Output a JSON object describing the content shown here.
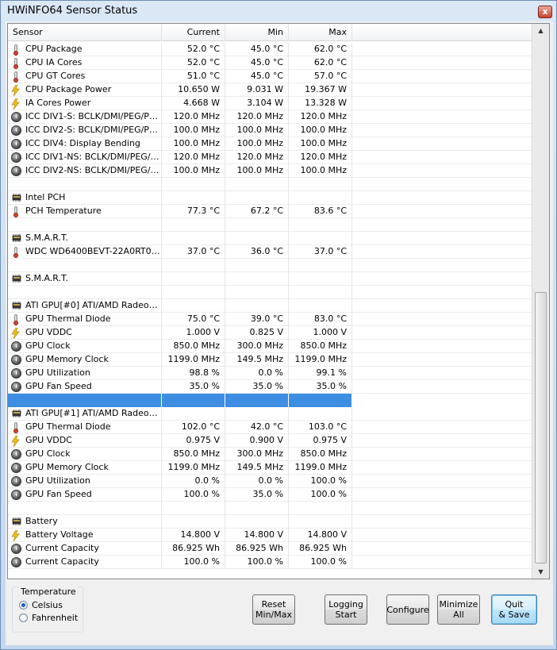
{
  "window": {
    "title": "HWiNFO64 Sensor Status",
    "close_label": "x"
  },
  "table": {
    "columns": [
      "Sensor",
      "Current",
      "Min",
      "Max"
    ],
    "rows": [
      {
        "type": "sensor",
        "icon": "thermometer-icon",
        "name": "CPU Package",
        "current": "52.0 °C",
        "min": "45.0 °C",
        "max": "62.0 °C"
      },
      {
        "type": "sensor",
        "icon": "thermometer-icon",
        "name": "CPU IA Cores",
        "current": "52.0 °C",
        "min": "45.0 °C",
        "max": "62.0 °C"
      },
      {
        "type": "sensor",
        "icon": "thermometer-icon",
        "name": "CPU GT Cores",
        "current": "51.0 °C",
        "min": "45.0 °C",
        "max": "57.0 °C"
      },
      {
        "type": "sensor",
        "icon": "lightning-icon",
        "name": "CPU Package Power",
        "current": "10.650 W",
        "min": "9.031 W",
        "max": "19.367 W"
      },
      {
        "type": "sensor",
        "icon": "lightning-icon",
        "name": "IA Cores Power",
        "current": "4.668 W",
        "min": "3.104 W",
        "max": "13.328 W"
      },
      {
        "type": "sensor",
        "icon": "clock-icon",
        "name": "ICC DIV1-S: BCLK/DMI/PEG/PCI...",
        "current": "120.0 MHz",
        "min": "120.0 MHz",
        "max": "120.0 MHz"
      },
      {
        "type": "sensor",
        "icon": "clock-icon",
        "name": "ICC DIV2-S: BCLK/DMI/PEG/PCI...",
        "current": "100.0 MHz",
        "min": "100.0 MHz",
        "max": "100.0 MHz"
      },
      {
        "type": "sensor",
        "icon": "clock-icon",
        "name": "ICC DIV4: Display Bending",
        "current": "100.0 MHz",
        "min": "100.0 MHz",
        "max": "100.0 MHz"
      },
      {
        "type": "sensor",
        "icon": "clock-icon",
        "name": "ICC DIV1-NS: BCLK/DMI/PEG/PC...",
        "current": "120.0 MHz",
        "min": "120.0 MHz",
        "max": "120.0 MHz"
      },
      {
        "type": "sensor",
        "icon": "clock-icon",
        "name": "ICC DIV2-NS: BCLK/DMI/PEG/PC...",
        "current": "100.0 MHz",
        "min": "100.0 MHz",
        "max": "100.0 MHz"
      },
      {
        "type": "blank"
      },
      {
        "type": "group",
        "icon": "chip-icon",
        "name": "Intel PCH"
      },
      {
        "type": "sensor",
        "icon": "thermometer-icon",
        "name": "PCH Temperature",
        "current": "77.3 °C",
        "min": "67.2 °C",
        "max": "83.6 °C"
      },
      {
        "type": "blank"
      },
      {
        "type": "group",
        "icon": "chip-icon",
        "name": "S.M.A.R.T."
      },
      {
        "type": "sensor",
        "icon": "thermometer-icon",
        "name": "WDC WD6400BEVT-22A0RT0 [...",
        "current": "37.0 °C",
        "min": "36.0 °C",
        "max": "37.0 °C"
      },
      {
        "type": "blank"
      },
      {
        "type": "group",
        "icon": "chip-icon",
        "name": "S.M.A.R.T."
      },
      {
        "type": "blank"
      },
      {
        "type": "group",
        "icon": "chip-icon",
        "name": "ATI GPU[#0] ATI/AMD Radeon ..."
      },
      {
        "type": "sensor",
        "icon": "thermometer-icon",
        "name": "GPU Thermal Diode",
        "current": "75.0 °C",
        "min": "39.0 °C",
        "max": "83.0 °C"
      },
      {
        "type": "sensor",
        "icon": "lightning-icon",
        "name": "GPU VDDC",
        "current": "1.000 V",
        "min": "0.825 V",
        "max": "1.000 V"
      },
      {
        "type": "sensor",
        "icon": "clock-icon",
        "name": "GPU Clock",
        "current": "850.0 MHz",
        "min": "300.0 MHz",
        "max": "850.0 MHz"
      },
      {
        "type": "sensor",
        "icon": "clock-icon",
        "name": "GPU Memory Clock",
        "current": "1199.0 MHz",
        "min": "149.5 MHz",
        "max": "1199.0 MHz"
      },
      {
        "type": "sensor",
        "icon": "clock-icon",
        "name": "GPU Utilization",
        "current": "98.8 %",
        "min": "0.0 %",
        "max": "99.1 %"
      },
      {
        "type": "sensor",
        "icon": "clock-icon",
        "name": "GPU Fan Speed",
        "current": "35.0 %",
        "min": "35.0 %",
        "max": "35.0 %"
      },
      {
        "type": "selected"
      },
      {
        "type": "group",
        "icon": "chip-icon",
        "name": "ATI GPU[#1] ATI/AMD Radeon ..."
      },
      {
        "type": "sensor",
        "icon": "thermometer-icon",
        "name": "GPU Thermal Diode",
        "current": "102.0 °C",
        "min": "42.0 °C",
        "max": "103.0 °C"
      },
      {
        "type": "sensor",
        "icon": "lightning-icon",
        "name": "GPU VDDC",
        "current": "0.975 V",
        "min": "0.900 V",
        "max": "0.975 V"
      },
      {
        "type": "sensor",
        "icon": "clock-icon",
        "name": "GPU Clock",
        "current": "850.0 MHz",
        "min": "300.0 MHz",
        "max": "850.0 MHz"
      },
      {
        "type": "sensor",
        "icon": "clock-icon",
        "name": "GPU Memory Clock",
        "current": "1199.0 MHz",
        "min": "149.5 MHz",
        "max": "1199.0 MHz"
      },
      {
        "type": "sensor",
        "icon": "clock-icon",
        "name": "GPU Utilization",
        "current": "0.0 %",
        "min": "0.0 %",
        "max": "100.0 %"
      },
      {
        "type": "sensor",
        "icon": "clock-icon",
        "name": "GPU Fan Speed",
        "current": "100.0 %",
        "min": "35.0 %",
        "max": "100.0 %"
      },
      {
        "type": "blank"
      },
      {
        "type": "group",
        "icon": "chip-icon",
        "name": "Battery"
      },
      {
        "type": "sensor",
        "icon": "lightning-icon",
        "name": "Battery Voltage",
        "current": "14.800 V",
        "min": "14.800 V",
        "max": "14.800 V"
      },
      {
        "type": "sensor",
        "icon": "clock-icon",
        "name": "Current Capacity",
        "current": "86.925 Wh",
        "min": "86.925 Wh",
        "max": "86.925 Wh"
      },
      {
        "type": "sensor",
        "icon": "clock-icon",
        "name": "Current Capacity",
        "current": "100.0 %",
        "min": "100.0 %",
        "max": "100.0 %"
      }
    ]
  },
  "scrollbar": {
    "up_arrow": "▲",
    "down_arrow": "▼"
  },
  "temperature": {
    "legend": "Temperature",
    "options": [
      {
        "label": "Celsius",
        "selected": true
      },
      {
        "label": "Fahrenheit",
        "selected": false
      }
    ]
  },
  "buttons": {
    "reset": "Reset\nMin/Max",
    "logging": "Logging\nStart",
    "configure": "Configure",
    "minimize": "Minimize\nAll",
    "quit": "Quit\n& Save"
  },
  "colors": {
    "selection": "#3d8ee2",
    "title_gradient_top": "#dbe8f6",
    "close_button": "#c7412a"
  }
}
